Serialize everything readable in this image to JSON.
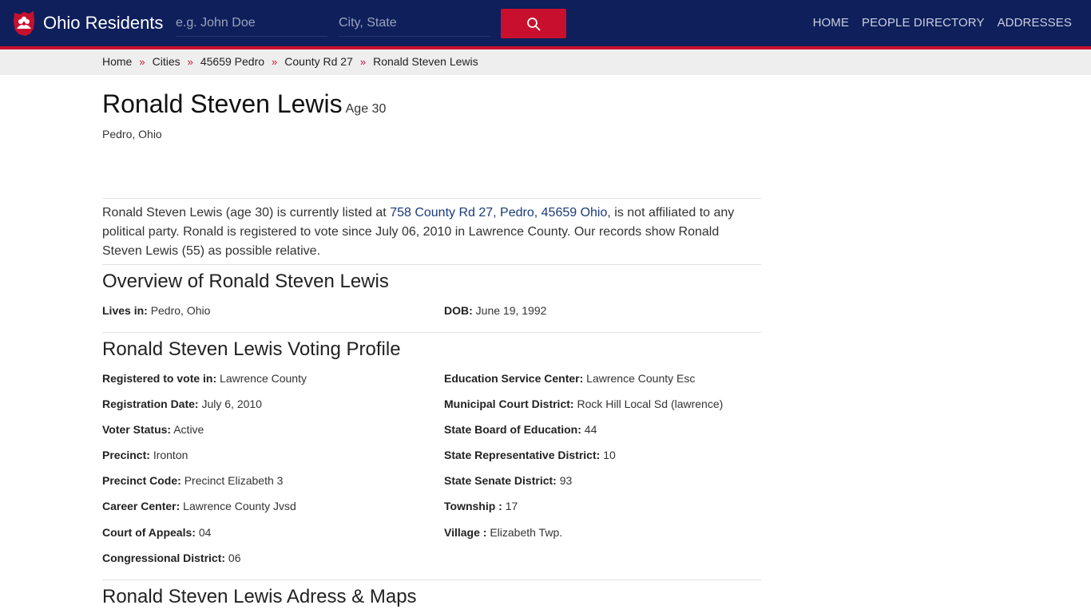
{
  "header": {
    "brand": "Ohio Residents",
    "name_placeholder": "e.g. John Doe",
    "city_placeholder": "City, State",
    "nav": [
      "HOME",
      "PEOPLE DIRECTORY",
      "ADDRESSES"
    ],
    "colors": {
      "navy": "#0e1f5b",
      "accent": "#c8102e"
    }
  },
  "breadcrumb": [
    "Home",
    "Cities",
    "45659 Pedro",
    "County Rd 27",
    "Ronald Steven Lewis"
  ],
  "breadcrumb_separator": "»",
  "person": {
    "name": "Ronald Steven Lewis",
    "age_label": "Age 30",
    "location": "Pedro, Ohio"
  },
  "intro": {
    "p1": "Ronald Steven Lewis (age 30) is currently listed at ",
    "address_link": "758 County Rd 27, Pedro, 45659 Ohio",
    "p2": ", is not affiliated to any political party. Ronald is registered to vote since July 06, 2010 in Lawrence County. Our records show Ronald Steven Lewis (55) as possible relative."
  },
  "overview": {
    "title": "Overview of Ronald Steven Lewis",
    "lives_in_label": "Lives in:",
    "lives_in": "Pedro, Ohio",
    "dob_label": "DOB:",
    "dob": "June 19, 1992"
  },
  "voting": {
    "title": "Ronald Steven Lewis Voting Profile",
    "left": [
      {
        "label": "Registered to vote in:",
        "value": "Lawrence County"
      },
      {
        "label": "Registration Date:",
        "value": "July 6, 2010"
      },
      {
        "label": "Voter Status:",
        "value": "Active"
      },
      {
        "label": "Precinct:",
        "value": "Ironton"
      },
      {
        "label": "Precinct Code:",
        "value": "Precinct Elizabeth 3"
      },
      {
        "label": "Career Center:",
        "value": "Lawrence County Jvsd"
      },
      {
        "label": "Court of Appeals:",
        "value": "04"
      },
      {
        "label": "Congressional District:",
        "value": "06"
      }
    ],
    "right": [
      {
        "label": "Education Service Center:",
        "value": "Lawrence County Esc"
      },
      {
        "label": "Municipal Court District:",
        "value": "Rock Hill Local Sd (lawrence)"
      },
      {
        "label": "State Board of Education:",
        "value": "44"
      },
      {
        "label": "State Representative District:",
        "value": "10"
      },
      {
        "label": "State Senate District:",
        "value": "93"
      },
      {
        "label": "Township :",
        "value": "17"
      },
      {
        "label": "Village :",
        "value": "Elizabeth Twp."
      }
    ]
  },
  "address_section": {
    "title": "Ronald Steven Lewis Adress & Maps"
  }
}
